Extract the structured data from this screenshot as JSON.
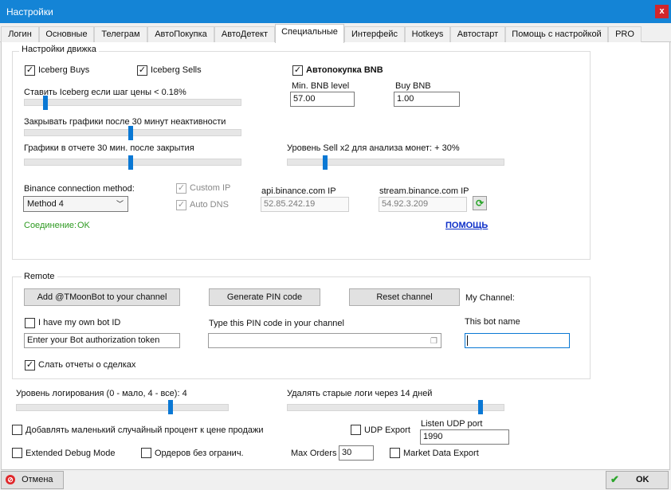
{
  "window": {
    "title": "Настройки",
    "close_label": "x"
  },
  "tabs": [
    "Логин",
    "Основные",
    "Телеграм",
    "АвтоПокупка",
    "АвтоДетект",
    "Специальные",
    "Интерфейс",
    "Hotkeys",
    "Автостарт",
    "Помощь с настройкой",
    "PRO"
  ],
  "active_tab": "Специальные",
  "engine": {
    "legend": "Настройки движка",
    "iceberg_buys": {
      "label": "Iceberg Buys",
      "checked": true
    },
    "iceberg_sells": {
      "label": "Iceberg Sells",
      "checked": true
    },
    "auto_bnb": {
      "label": "Автопокупка BNB",
      "checked": true
    },
    "iceberg_step": {
      "label": "Ставить Iceberg если шаг цены < 0.18%",
      "level": 0.09
    },
    "close_charts": {
      "label": "Закрывать графики после 30 минут неактивности",
      "level": 0.49
    },
    "report_charts": {
      "label": "Графики в отчете 30 мин. после закрытия",
      "level": 0.49
    },
    "min_bnb": {
      "label": "Min. BNB level",
      "value": "57.00"
    },
    "buy_bnb": {
      "label": "Buy BNB",
      "value": "1.00"
    },
    "sell_x2": {
      "label": "Уровень Sell x2 для анализа монет: + 30%",
      "level": 0.17
    },
    "connection": {
      "label": "Binance connection method:",
      "selected": "Method 4",
      "custom_ip": {
        "label": "Custom IP",
        "checked": true
      },
      "auto_dns": {
        "label": "Auto DNS",
        "checked": true
      },
      "api_label": "api.binance.com IP",
      "api_value": "52.85.242.19",
      "stream_label": "stream.binance.com IP",
      "stream_value": "54.92.3.209",
      "status_label": "Соединение:",
      "status_value": "OK",
      "help_link": "ПОМОЩЬ"
    }
  },
  "remote": {
    "legend": "Remote",
    "add_bot_button": "Add @TMoonBot to your channel",
    "generate_pin_button": "Generate PIN code",
    "reset_channel_button": "Reset channel",
    "my_channel_label": "My Channel:",
    "own_bot": {
      "label": "I have my own bot ID",
      "checked": false
    },
    "token_placeholder": "Enter your Bot authorization token",
    "pin_label": "Type this PIN code in your channel",
    "pin_value": "",
    "bot_name_label": "This bot name",
    "bot_name_value": "",
    "send_reports": {
      "label": "Слать отчеты о сделках",
      "checked": true
    }
  },
  "logging": {
    "label": "Уровень логирования (0 - мало, 4 - все): 4",
    "level": 0.73
  },
  "old_logs": {
    "label": "Удалять старые логи через 14 дней",
    "level": 0.9
  },
  "random_percent": {
    "label": "Добавлять маленький случайный процент к цене продажи",
    "checked": false
  },
  "udp_export": {
    "label": "UDP Export",
    "checked": false
  },
  "listen_udp": {
    "label": "Listen UDP port",
    "value": "1990"
  },
  "extended_debug": {
    "label": "Extended Debug Mode",
    "checked": false
  },
  "orders_unlimited": {
    "label": "Ордеров без огранич.",
    "checked": false
  },
  "max_orders": {
    "label": "Max Orders",
    "value": "30"
  },
  "market_data_export": {
    "label": "Market Data Export",
    "checked": false
  },
  "footer": {
    "cancel": "Отмена",
    "ok": "OK"
  },
  "colors": {
    "accent": "#0a78d4",
    "titlebar": "#1484d6",
    "status_ok": "#2e9a21",
    "link": "#0c2ec8",
    "cancel_icon": "#e0262a",
    "ok_icon": "#2aa52a"
  },
  "icons": [
    "close-icon",
    "chevron-down-icon",
    "refresh-icon",
    "paste-icon",
    "cancel-icon",
    "check-icon"
  ]
}
